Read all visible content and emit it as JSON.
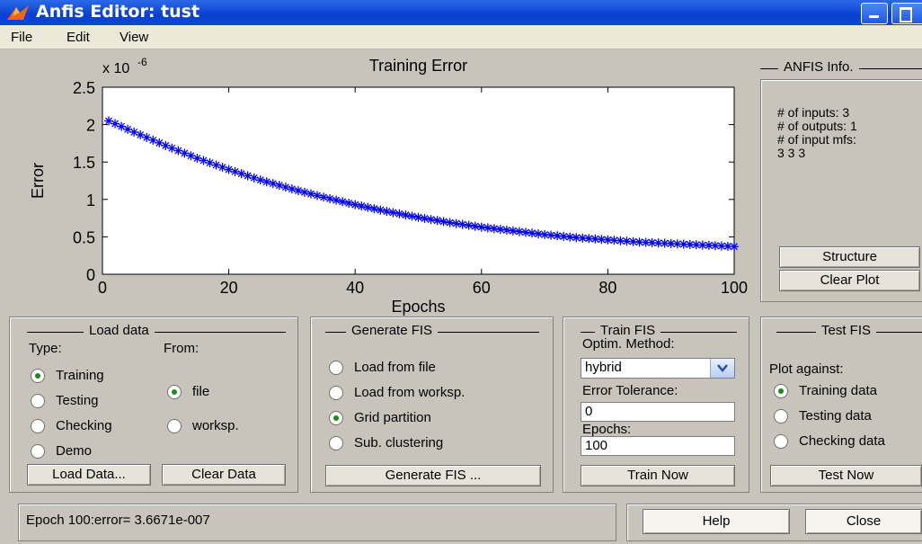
{
  "window": {
    "title": "Anfis Editor: tust"
  },
  "menu": {
    "items": [
      "File",
      "Edit",
      "View"
    ]
  },
  "chart_data": {
    "type": "scatter",
    "title": "Training Error",
    "xlabel": "Epochs",
    "ylabel": "Error",
    "exponent_label": "x 10",
    "exponent_power": "-6",
    "xlim": [
      0,
      100
    ],
    "ylim": [
      0,
      2.5
    ],
    "xticks": [
      "0",
      "20",
      "40",
      "60",
      "80",
      "100"
    ],
    "yticks": [
      "0",
      "0.5",
      "1",
      "1.5",
      "2",
      "2.5"
    ],
    "marker": "*",
    "color": "#0000ff",
    "series": [
      {
        "x": [
          1,
          5,
          10,
          15,
          20,
          25,
          30,
          35,
          40,
          45,
          50,
          55,
          60,
          65,
          70,
          75,
          80,
          85,
          90,
          95,
          100
        ],
        "values": [
          2.05,
          1.9,
          1.72,
          1.55,
          1.4,
          1.26,
          1.14,
          1.03,
          0.93,
          0.84,
          0.76,
          0.69,
          0.63,
          0.58,
          0.53,
          0.49,
          0.46,
          0.43,
          0.41,
          0.39,
          0.37
        ]
      }
    ]
  },
  "anfis_info": {
    "title": "ANFIS Info.",
    "lines": [
      "# of inputs: 3",
      "# of outputs: 1",
      "# of input mfs:",
      "3  3  3"
    ],
    "structure_button": "Structure",
    "clear_plot_button": "Clear Plot"
  },
  "load_data": {
    "title": "Load data",
    "type_label": "Type:",
    "from_label": "From:",
    "types": [
      {
        "label": "Training",
        "selected": true
      },
      {
        "label": "Testing",
        "selected": false
      },
      {
        "label": "Checking",
        "selected": false
      },
      {
        "label": "Demo",
        "selected": false
      }
    ],
    "sources": [
      {
        "label": "file",
        "selected": true
      },
      {
        "label": "worksp.",
        "selected": false
      }
    ],
    "load_button": "Load Data...",
    "clear_button": "Clear Data"
  },
  "generate_fis": {
    "title": "Generate FIS",
    "options": [
      {
        "label": "Load from file",
        "selected": false
      },
      {
        "label": "Load from worksp.",
        "selected": false
      },
      {
        "label": "Grid partition",
        "selected": true
      },
      {
        "label": "Sub. clustering",
        "selected": false
      }
    ],
    "button": "Generate FIS ..."
  },
  "train_fis": {
    "title": "Train FIS",
    "method_label": "Optim. Method:",
    "method_value": "hybrid",
    "tolerance_label": "Error Tolerance:",
    "tolerance_value": "0",
    "epochs_label": "Epochs:",
    "epochs_value": "100",
    "button": "Train Now"
  },
  "test_fis": {
    "title": "Test FIS",
    "plot_label": "Plot against:",
    "options": [
      {
        "label": "Training data",
        "selected": true
      },
      {
        "label": "Testing data",
        "selected": false
      },
      {
        "label": "Checking data",
        "selected": false
      }
    ],
    "button": "Test Now"
  },
  "status": {
    "text": "Epoch 100:error= 3.6671e-007"
  },
  "footer": {
    "help_button": "Help",
    "close_button": "Close"
  }
}
